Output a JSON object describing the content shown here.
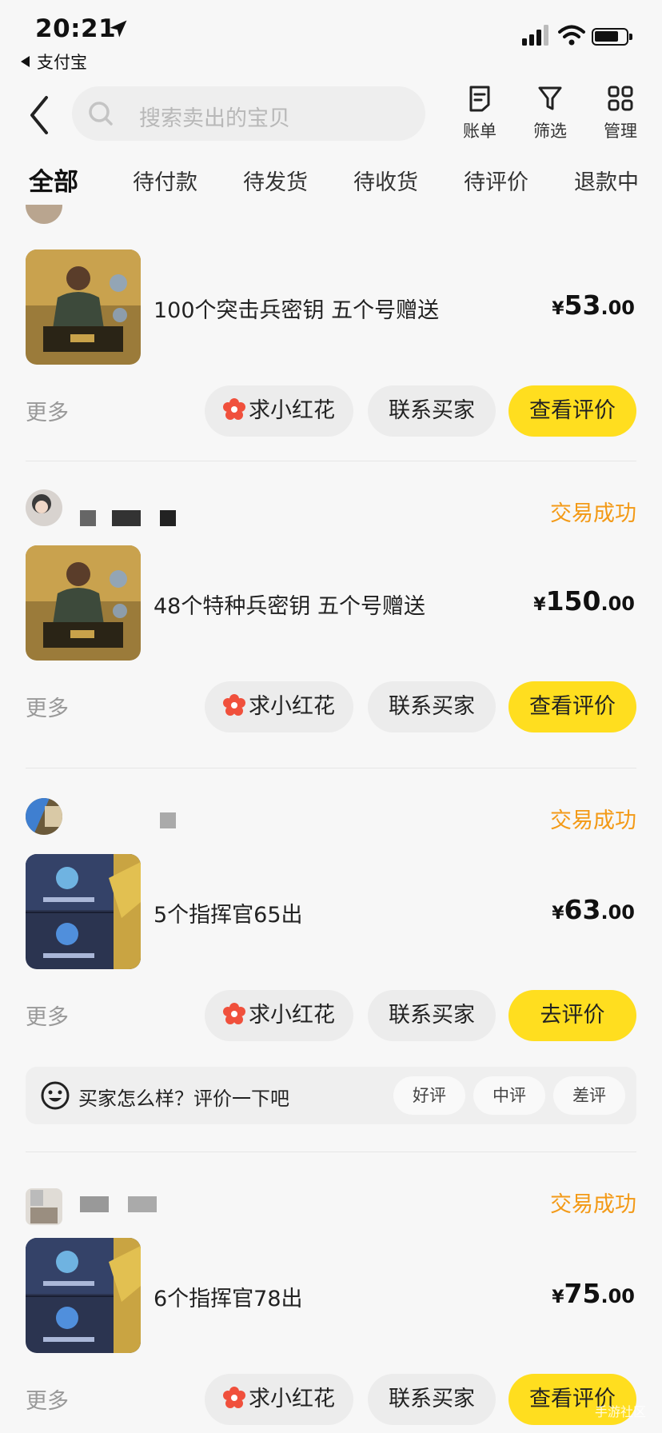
{
  "status_bar": {
    "time": "20:21",
    "back_app": "支付宝"
  },
  "header": {
    "search_placeholder": "搜索卖出的宝贝",
    "tools": [
      {
        "label": "账单",
        "icon": "bill-icon"
      },
      {
        "label": "筛选",
        "icon": "filter-icon"
      },
      {
        "label": "管理",
        "icon": "grid-icon"
      }
    ]
  },
  "tabs": [
    {
      "label": "全部",
      "active": true
    },
    {
      "label": "待付款"
    },
    {
      "label": "待发货"
    },
    {
      "label": "待收货"
    },
    {
      "label": "待评价"
    },
    {
      "label": "退款中"
    }
  ],
  "orders": [
    {
      "status": "",
      "title": "100个突击兵密钥 五个号赠送",
      "price_int": "53",
      "price_dec": ".00",
      "more": "更多",
      "buttons": [
        "求小红花",
        "联系买家",
        "查看评价"
      ]
    },
    {
      "status": "交易成功",
      "title": "48个特种兵密钥 五个号赠送",
      "price_int": "150",
      "price_dec": ".00",
      "more": "更多",
      "buttons": [
        "求小红花",
        "联系买家",
        "查看评价"
      ]
    },
    {
      "status": "交易成功",
      "title": "5个指挥官65出",
      "price_int": "63",
      "price_dec": ".00",
      "more": "更多",
      "buttons": [
        "求小红花",
        "联系买家",
        "去评价"
      ],
      "rating_prompt": {
        "question": "买家怎么样？评价一下吧",
        "options": [
          "好评",
          "中评",
          "差评"
        ]
      }
    },
    {
      "status": "交易成功",
      "title": "6个指挥官78出",
      "price_int": "75",
      "price_dec": ".00",
      "more": "更多",
      "buttons": [
        "求小红花",
        "联系买家",
        "查看评价"
      ]
    }
  ],
  "currency_symbol": "¥",
  "watermark": "手游社区",
  "colors": {
    "accent_yellow": "#ffde1f",
    "status_orange": "#f39a17",
    "flower_red": "#f0503c"
  }
}
